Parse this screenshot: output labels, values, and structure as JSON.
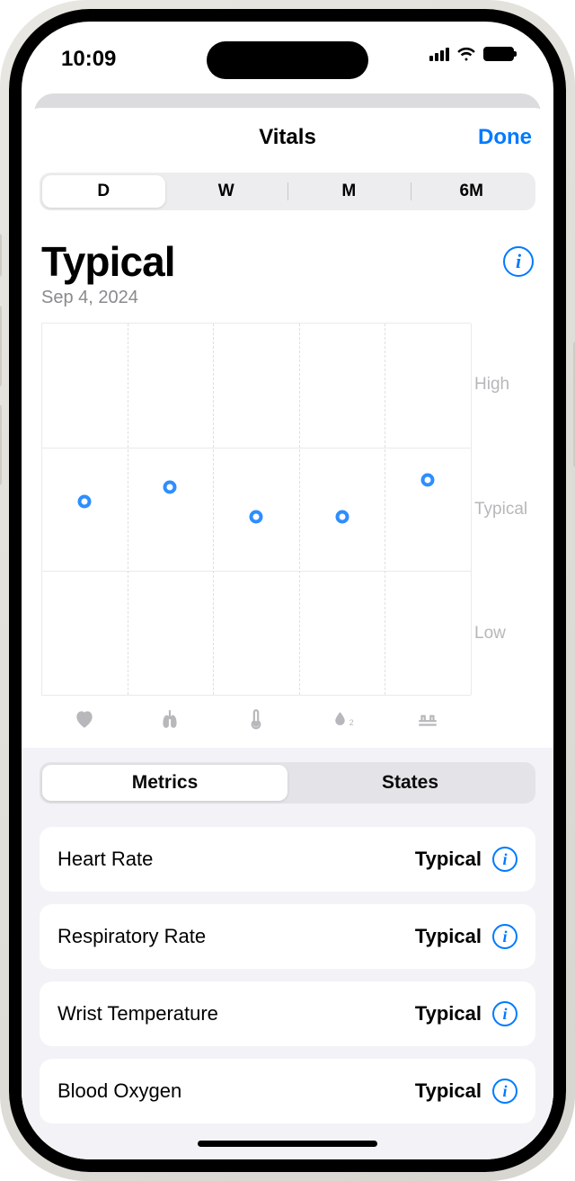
{
  "status": {
    "time": "10:09"
  },
  "nav": {
    "title": "Vitals",
    "done": "Done"
  },
  "range": {
    "options": [
      "D",
      "W",
      "M",
      "6M"
    ],
    "selected": 0
  },
  "summary": {
    "status": "Typical",
    "date": "Sep 4, 2024"
  },
  "yLabels": {
    "high": "High",
    "typical": "Typical",
    "low": "Low"
  },
  "tabs": {
    "options": [
      "Metrics",
      "States"
    ],
    "selected": 0
  },
  "metrics": [
    {
      "name": "Heart Rate",
      "value": "Typical",
      "icon": "heart"
    },
    {
      "name": "Respiratory Rate",
      "value": "Typical",
      "icon": "lungs"
    },
    {
      "name": "Wrist Temperature",
      "value": "Typical",
      "icon": "thermometer"
    },
    {
      "name": "Blood Oxygen",
      "value": "Typical",
      "icon": "o2"
    }
  ],
  "chart_data": {
    "type": "scatter",
    "title": "Typical",
    "ylabel": "",
    "ylim_labels": [
      "Low",
      "Typical",
      "High"
    ],
    "categories": [
      "heart",
      "lungs",
      "thermometer",
      "o2",
      "sleep"
    ],
    "y_values": [
      52,
      56,
      48,
      48,
      58
    ],
    "y_range": [
      0,
      100
    ],
    "band_lines": [
      33.3,
      66.6
    ]
  }
}
